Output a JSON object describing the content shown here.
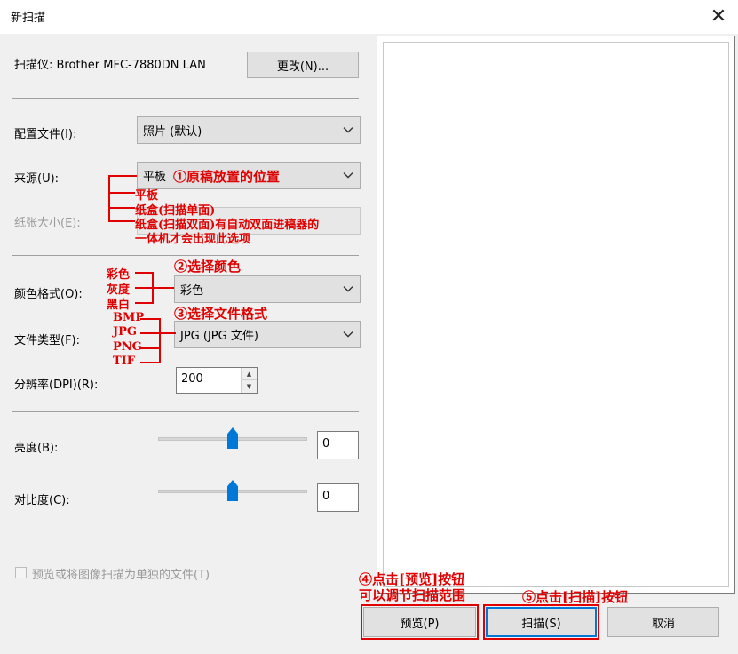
{
  "window": {
    "title": "新扫描",
    "close_glyph": "✕"
  },
  "scanner": {
    "label": "扫描仪: Brother MFC-7880DN LAN",
    "change_button": "更改(N)..."
  },
  "profile": {
    "label": "配置文件(I):",
    "value": "照片 (默认)"
  },
  "source": {
    "label": "来源(U):",
    "value": "平板"
  },
  "paper_size": {
    "label": "纸张大小(E):"
  },
  "color_format": {
    "label": "颜色格式(O):",
    "value": "彩色"
  },
  "file_type": {
    "label": "文件类型(F):",
    "value": "JPG (JPG 文件)"
  },
  "resolution": {
    "label": "分辨率(DPI)(R):",
    "value": "200"
  },
  "brightness": {
    "label": "亮度(B):",
    "value": "0",
    "level": 0.5
  },
  "contrast": {
    "label": "对比度(C):",
    "value": "0",
    "level": 0.5
  },
  "separate_files": {
    "label": "预览或将图像扫描为单独的文件(T)"
  },
  "buttons": {
    "preview": "预览(P)",
    "scan": "扫描(S)",
    "cancel": "取消"
  },
  "annotations": {
    "step1": "①原稿放置的位置",
    "source_opt1": "平板",
    "source_opt2": "纸盒(扫描单面)",
    "source_opt3": "纸盒(扫描双面)有自动双面进稿器的",
    "source_opt3b": "一体机才会出现此选项",
    "step2": "②选择颜色",
    "color_opt1": "彩色",
    "color_opt2": "灰度",
    "color_opt3": "黑白",
    "step3": "③选择文件格式",
    "type_opt1": "BMP",
    "type_opt2": "JPG",
    "type_opt3": "PNG",
    "type_opt4": "TIF",
    "step4": "④点击[预览]按钮",
    "step4b": "可以调节扫描范围",
    "step5": "⑤点击[扫描]按钮"
  },
  "colors": {
    "annotation": "#e00000",
    "accent": "#0078d7"
  }
}
